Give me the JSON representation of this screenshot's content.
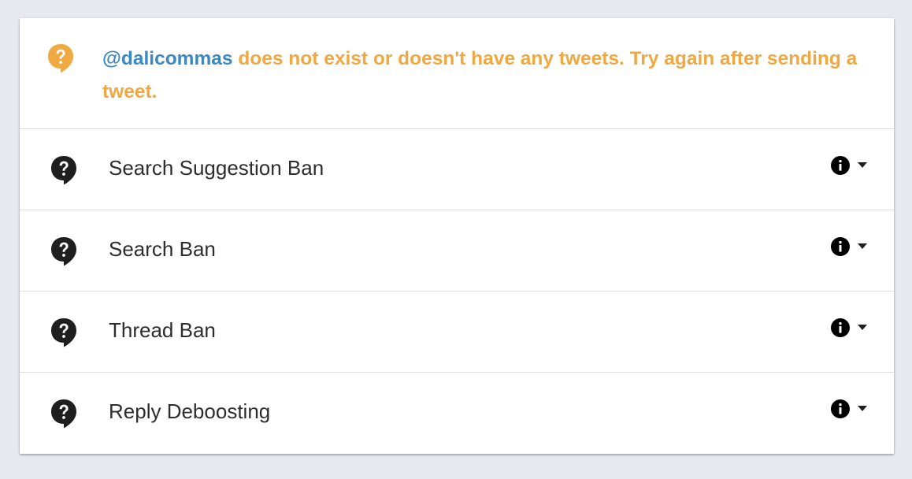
{
  "colors": {
    "warning": "#f0a840",
    "handle_link": "#3b88c3",
    "row_text": "#2d2d2d",
    "icon_dark": "#1f1f1f",
    "background": "#e6eaee"
  },
  "notice": {
    "icon": "question-bubble-icon",
    "handle": "@dalicommas",
    "message": " does not exist or doesn't have any tweets. Try again after sending a tweet."
  },
  "checks": [
    {
      "label": "Search Suggestion Ban",
      "status_icon": "question-bubble-icon",
      "info_icon": "info-icon",
      "toggle_icon": "caret-down-icon"
    },
    {
      "label": "Search Ban",
      "status_icon": "question-bubble-icon",
      "info_icon": "info-icon",
      "toggle_icon": "caret-down-icon"
    },
    {
      "label": "Thread Ban",
      "status_icon": "question-bubble-icon",
      "info_icon": "info-icon",
      "toggle_icon": "caret-down-icon"
    },
    {
      "label": "Reply Deboosting",
      "status_icon": "question-bubble-icon",
      "info_icon": "info-icon",
      "toggle_icon": "caret-down-icon"
    }
  ]
}
